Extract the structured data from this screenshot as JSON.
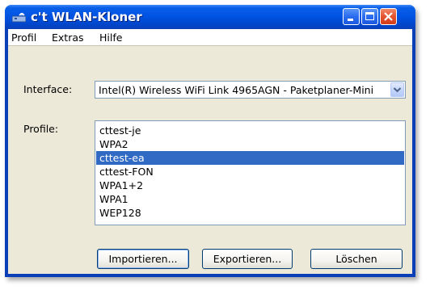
{
  "window": {
    "title": "c't WLAN-Kloner"
  },
  "menu": {
    "items": [
      "Profil",
      "Extras",
      "Hilfe"
    ]
  },
  "form": {
    "interface_label": "Interface:",
    "interface_value": "Intel(R) Wireless WiFi Link 4965AGN - Paketplaner-Mini",
    "profiles_label": "Profile:",
    "profiles": [
      "cttest-je",
      "WPA2",
      "cttest-ea",
      "cttest-FON",
      "WPA1+2",
      "WPA1",
      "WEP128"
    ],
    "selected_profile": "cttest-ea"
  },
  "buttons": {
    "import": "Importieren...",
    "export": "Exportieren...",
    "delete": "Löschen"
  },
  "colors": {
    "titlebar": "#0054e3",
    "selection": "#316ac5",
    "window_bg": "#ece9d8",
    "close_button": "#e5532f"
  }
}
